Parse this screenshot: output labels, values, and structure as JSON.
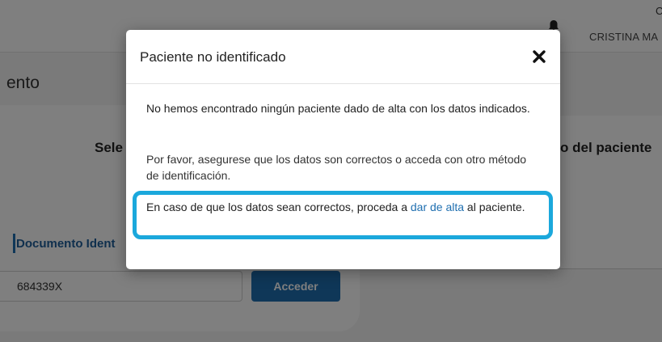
{
  "header": {
    "user_initial": "C",
    "user_name": "CRISTINA MA"
  },
  "background": {
    "page_title": "ento",
    "step_left": "Sele",
    "step_right": "o del paciente",
    "tab_doc_label": "Documento Ident",
    "document_value": "684339X",
    "access_button": "Acceder"
  },
  "modal": {
    "title": "Paciente no identificado",
    "close_symbol": "✕",
    "message_1": "No hemos encontrado ningún paciente dado de alta con los datos indicados.",
    "message_2": "Por favor, asegurese que los datos son correctos o acceda con otro método de identificación.",
    "message_3_before": "En caso de que los datos sean correctos, proceda a ",
    "message_3_link": "dar de alta",
    "message_3_after": " al paciente.",
    "highlight_color": "#1ba8dc",
    "link_color": "#1f6fb0"
  }
}
